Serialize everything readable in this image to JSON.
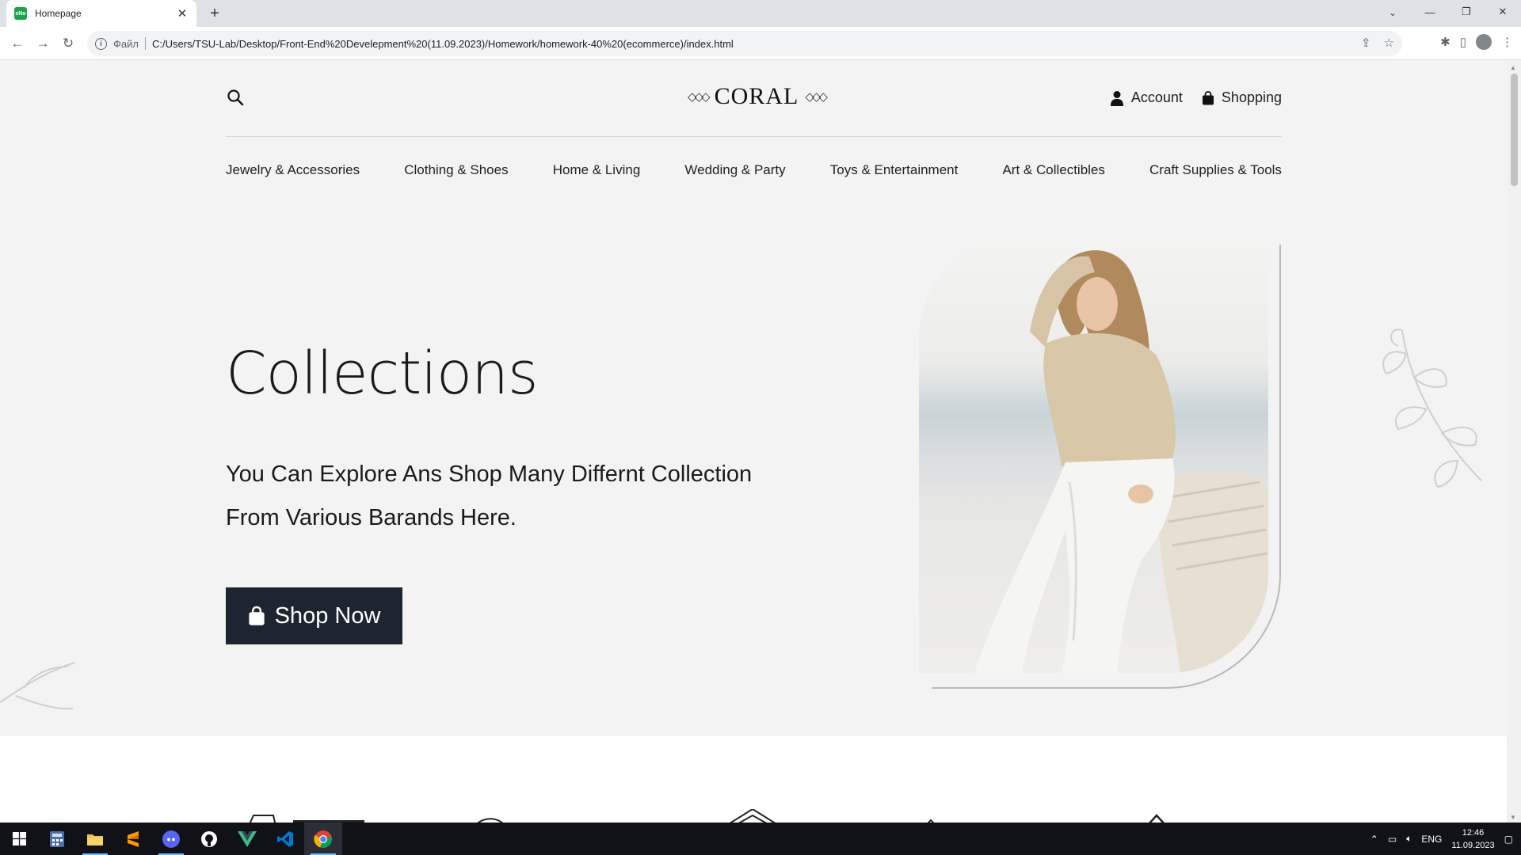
{
  "browser": {
    "tab_title": "Homepage",
    "favicon_text": "sNo",
    "scheme_label": "Файл",
    "url": "C:/Users/TSU-Lab/Desktop/Front-End%20Develepment%20(11.09.2023)/Homework/homework-40%20(ecommerce)/index.html"
  },
  "header": {
    "logo": "CORAL",
    "account_label": "Account",
    "shopping_label": "Shopping"
  },
  "nav": {
    "categories": [
      "Jewelry & Accessories",
      "Clothing & Shoes",
      "Home & Living",
      "Wedding & Party",
      "Toys & Entertainment",
      "Art & Collectibles",
      "Craft Supplies & Tools"
    ]
  },
  "hero": {
    "title": "Collections",
    "subtitle": "You Can Explore Ans Shop Many Differnt Collection From Various Barands Here.",
    "button_label": "Shop Now"
  },
  "taskbar": {
    "apps": [
      "calculator",
      "file-explorer",
      "sublime-text",
      "discord",
      "github",
      "vue",
      "vscode",
      "chrome"
    ],
    "language": "ENG",
    "time": "12:46",
    "date": "11.09.2023"
  },
  "colors": {
    "page_bg": "#f3f3f3",
    "button_bg": "#1d2630",
    "taskbar_bg": "#101218"
  }
}
